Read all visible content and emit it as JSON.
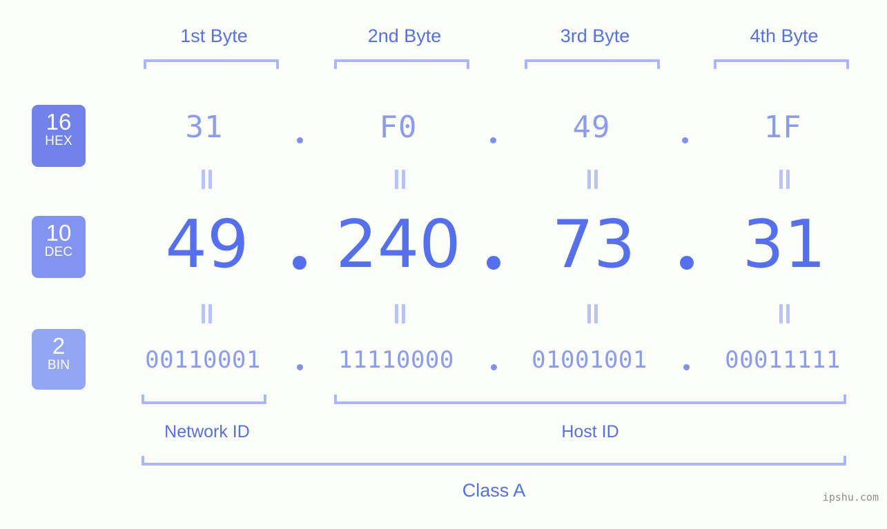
{
  "byte_headers": [
    {
      "label": "1st Byte"
    },
    {
      "label": "2nd Byte"
    },
    {
      "label": "3rd Byte"
    },
    {
      "label": "4th Byte"
    }
  ],
  "rows": {
    "hex": {
      "badge_num": "16",
      "badge_label": "HEX",
      "values": [
        "31",
        "F0",
        "49",
        "1F"
      ],
      "separator": "."
    },
    "dec": {
      "badge_num": "10",
      "badge_label": "DEC",
      "values": [
        "49",
        "240",
        "73",
        "31"
      ],
      "separator": "."
    },
    "bin": {
      "badge_num": "2",
      "badge_label": "BIN",
      "values": [
        "00110001",
        "11110000",
        "01001001",
        "00011111"
      ],
      "separator": "."
    }
  },
  "equals_marks": {
    "glyph": "||"
  },
  "id_sections": [
    {
      "label": "Network ID"
    },
    {
      "label": "Host ID"
    }
  ],
  "class_label": "Class A",
  "watermark": "ipshu.com",
  "colors": {
    "background": "#fbfdf8",
    "accent_strong": "#5570ee",
    "accent_mid": "#8a9bf0",
    "accent_light": "#aab6fb",
    "badge_hex": "#7182ea",
    "badge_dec": "#8294f1",
    "badge_bin": "#92a6f6",
    "watermark": "#8d8d8d"
  },
  "ip_address": {
    "dec": "49.240.73.31",
    "hex": "31.F0.49.1F",
    "bin": "00110001.11110000.01001001.00011111"
  }
}
